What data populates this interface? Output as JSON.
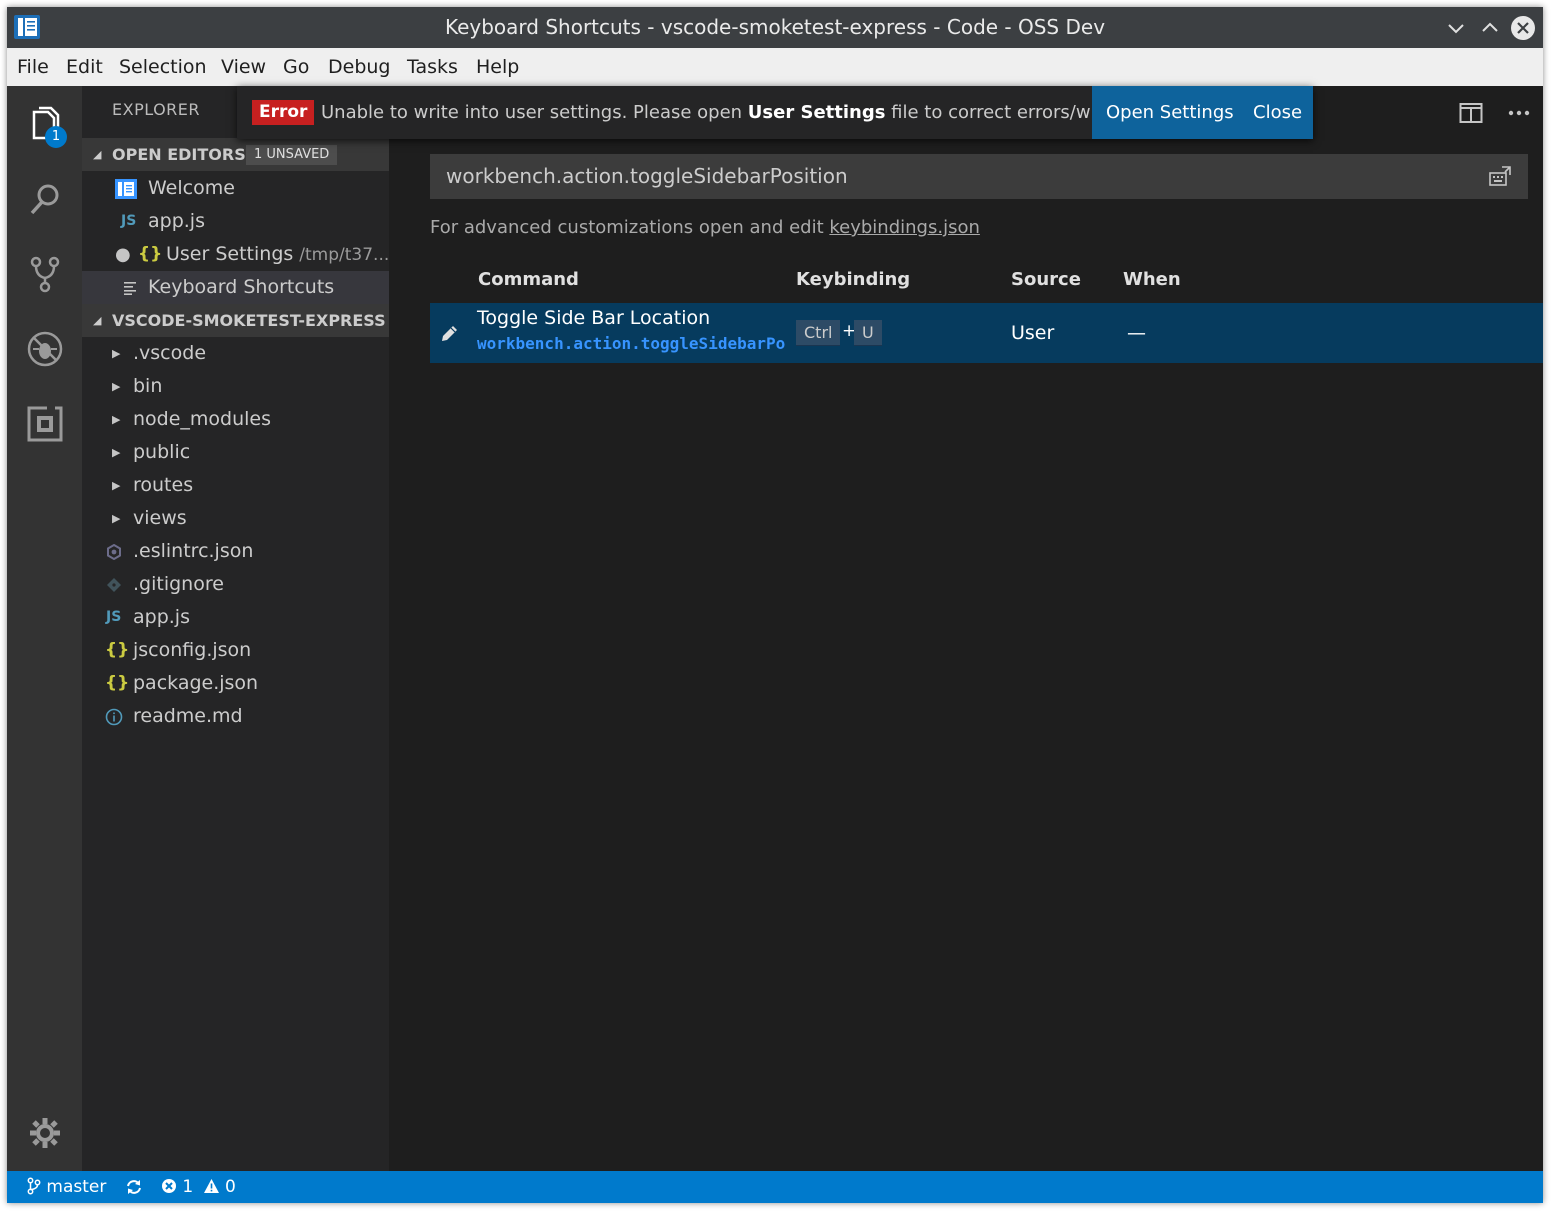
{
  "window": {
    "title": "Keyboard Shortcuts - vscode-smoketest-express - Code - OSS Dev"
  },
  "menu": {
    "items": [
      "File",
      "Edit",
      "Selection",
      "View",
      "Go",
      "Debug",
      "Tasks",
      "Help"
    ]
  },
  "activity_bar": {
    "explorer_badge": "1",
    "icons": [
      "explorer-icon",
      "search-icon",
      "source-control-icon",
      "debug-icon",
      "extensions-icon",
      "gear-icon"
    ]
  },
  "sidebar": {
    "header": "EXPLORER",
    "open_editors": {
      "title": "OPEN EDITORS",
      "badge": "1 UNSAVED",
      "items": [
        {
          "label": "Welcome",
          "icon": "welcome-icon"
        },
        {
          "label": "app.js",
          "icon": "JS"
        },
        {
          "label": "User Settings",
          "path": "/tmp/t37...",
          "icon": "{}",
          "dirty": true
        },
        {
          "label": "Keyboard Shortcuts",
          "icon": "keyboard-shortcuts-icon",
          "selected": true
        }
      ]
    },
    "project": {
      "title": "VSCODE-SMOKETEST-EXPRESS",
      "folders": [
        ".vscode",
        "bin",
        "node_modules",
        "public",
        "routes",
        "views"
      ],
      "files": [
        {
          "label": ".eslintrc.json",
          "icon": "eslint-icon"
        },
        {
          "label": ".gitignore",
          "icon": "git-icon"
        },
        {
          "label": "app.js",
          "icon": "JS"
        },
        {
          "label": "jsconfig.json",
          "icon": "{}"
        },
        {
          "label": "package.json",
          "icon": "{}"
        },
        {
          "label": "readme.md",
          "icon": "info-icon"
        }
      ]
    }
  },
  "notification": {
    "badge": "Error",
    "message_before": "Unable to write into user settings. Please open ",
    "message_bold": "User Settings",
    "message_after": " file to correct errors/warnings in it and try again.",
    "open_settings": "Open Settings",
    "close": "Close"
  },
  "keybindings": {
    "search_value": "workbench.action.toggleSidebarPosition",
    "advanced_text": "For advanced customizations open and edit ",
    "advanced_link": "keybindings.json",
    "columns": [
      "Command",
      "Keybinding",
      "Source",
      "When"
    ],
    "rows": [
      {
        "command": "Toggle Side Bar Location",
        "command_id": "workbench.action.toggleSidebarPosition",
        "keys": [
          "Ctrl",
          "U"
        ],
        "plus": "+",
        "source": "User",
        "when": "—"
      }
    ]
  },
  "status_bar": {
    "branch": "master",
    "errors": "1",
    "warnings": "0"
  },
  "colors": {
    "accent": "#007acc",
    "error": "#c72020",
    "selection": "#063b5e"
  }
}
